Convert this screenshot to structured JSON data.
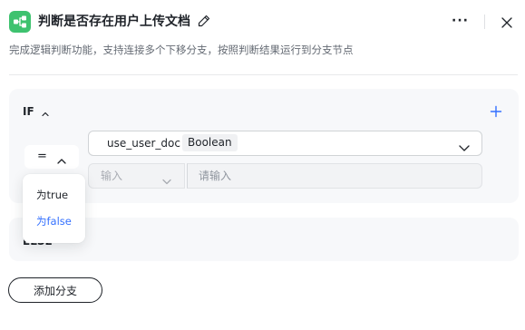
{
  "header": {
    "title": "判断是否存在用户上传文档",
    "description": "完成逻辑判断功能，支持连接多个下移分支，按照判断结果运行到分支节点",
    "icons": {
      "logo": "branch-node-icon",
      "edit": "pencil-icon",
      "more": "more-icon",
      "close": "close-icon"
    },
    "more_glyph": "···"
  },
  "if_branch": {
    "label": "IF",
    "condition": {
      "operator": "=",
      "variable": "use_user_doc",
      "variable_type": "Boolean",
      "value_source": "输入",
      "value_placeholder": "请输入",
      "value": ""
    }
  },
  "operator_dropdown": {
    "options": [
      "为true",
      "为false"
    ],
    "highlighted": "为false"
  },
  "else_branch": {
    "label": "ELSE"
  },
  "add_branch_label": "添加分支",
  "colors": {
    "brand_green": "#3ec26f",
    "accent_blue": "#3370ff",
    "card_bg": "#f7f8fa",
    "text_primary": "#1f2329",
    "text_secondary": "#646a73"
  }
}
